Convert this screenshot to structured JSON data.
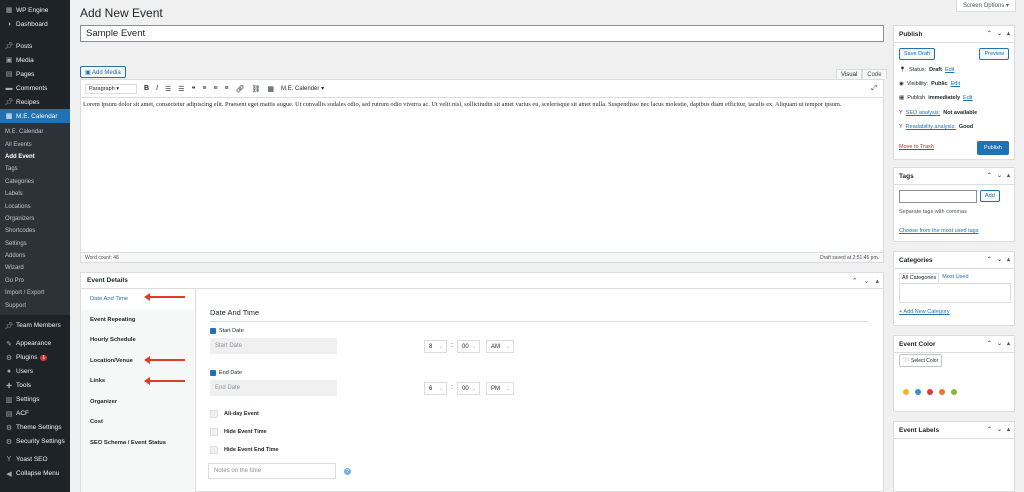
{
  "sidebar": {
    "top": [
      {
        "label": "WP Engine",
        "icon": "wpengine-icon"
      },
      {
        "label": "Dashboard",
        "icon": "dashboard-icon"
      },
      {
        "label": "Posts",
        "icon": "pin-icon"
      },
      {
        "label": "Media",
        "icon": "media-icon"
      },
      {
        "label": "Pages",
        "icon": "pages-icon"
      },
      {
        "label": "Comments",
        "icon": "comments-icon"
      },
      {
        "label": "Recipes",
        "icon": "pin-icon"
      },
      {
        "label": "M.E. Calendar",
        "icon": "calendar-icon"
      }
    ],
    "sub": [
      "M.E. Calendar",
      "All Events",
      "Add Event",
      "Tags",
      "Categories",
      "Labels",
      "Locations",
      "Organizers",
      "Shortcodes",
      "Settings",
      "Addons",
      "Wizard",
      "Go Pro",
      "Import / Export",
      "Support"
    ],
    "bottom": [
      {
        "label": "Team Members",
        "icon": "pin-icon"
      },
      {
        "label": "Appearance",
        "icon": "appearance-icon"
      },
      {
        "label": "Plugins",
        "icon": "plugins-icon",
        "badge": "1"
      },
      {
        "label": "Users",
        "icon": "users-icon"
      },
      {
        "label": "Tools",
        "icon": "tools-icon"
      },
      {
        "label": "Settings",
        "icon": "settings-icon"
      },
      {
        "label": "ACF",
        "icon": "acf-icon"
      },
      {
        "label": "Theme Settings",
        "icon": "gear-icon"
      },
      {
        "label": "Security Settings",
        "icon": "gear-icon"
      },
      {
        "label": "Yoast SEO",
        "icon": "yoast-icon"
      },
      {
        "label": "Collapse Menu",
        "icon": "collapse-icon"
      }
    ]
  },
  "header": {
    "title": "Add New Event",
    "screen_options": "Screen Options ▾"
  },
  "post_title": "Sample Event",
  "editor": {
    "add_media": "Add Media",
    "tab_visual": "Visual",
    "tab_code": "Code",
    "format": "Paragraph",
    "shortcode": "M.E. Calender",
    "content": "Lorem ipsum dolor sit amet, consectetur adipiscing elit. Praesent eget mattis augue. Ut convallis sodales odio, sed rutrum odio viverra ac. Ut velit nisl, sollicitudin sit amet varius eu, scelerisque sit amet nulla. Suspendisse nec lacus molestie, dapibus diam efficitur, iaculis ex. Aliquam ut tempor ipsum.",
    "word_count": "Word count: 46",
    "draft_saved": "Draft saved at 2:51:46 pm."
  },
  "event_details": {
    "title": "Event Details",
    "tabs": [
      "Date And Time",
      "Event Repeating",
      "Hourly Schedule",
      "Location/Venue",
      "Links",
      "Organizer",
      "Cost",
      "SEO Schema / Event Status"
    ],
    "section_title": "Date And Time",
    "start_label": "Start Date",
    "start_placeholder": "Start Date",
    "start_hour": "8",
    "start_min": "00",
    "start_ampm": "AM",
    "end_label": "End Date",
    "end_placeholder": "End Date",
    "end_hour": "6",
    "end_min": "00",
    "end_ampm": "PM",
    "colon": ":",
    "allday": "All-day Event",
    "hide_time": "Hide Event Time",
    "hide_end": "Hide Event End Time",
    "notes_placeholder": "Notes on the time",
    "arrow_color": "#e33b25"
  },
  "publish": {
    "title": "Publish",
    "save_draft": "Save Draft",
    "preview": "Preview",
    "status": "Status: ",
    "status_val": "Draft",
    "status_edit": "Edit",
    "visibility": "Visibility: ",
    "visibility_val": "Public",
    "visibility_edit": "Edit",
    "publish_when": "Publish ",
    "publish_when_val": "immediately",
    "publish_edit": "Edit",
    "seo": "SEO analysis:",
    "seo_val": "Not available",
    "read": "Readability analysis:",
    "read_val": "Good",
    "trash": "Move to Trash",
    "publish_btn": "Publish"
  },
  "tags": {
    "title": "Tags",
    "add": "Add",
    "hint": "Separate tags with commas",
    "choose": "Choose from the most used tags"
  },
  "categories": {
    "title": "Categories",
    "tab_all": "All Categories",
    "tab_most": "Most Used",
    "add_new": "+ Add New Category"
  },
  "event_color": {
    "title": "Event Color",
    "select": "Select Color",
    "swatches": [
      "#f0b81e",
      "#3a8fd6",
      "#dd3b3b",
      "#e57833",
      "#8db532"
    ]
  },
  "event_labels": {
    "title": "Event Labels"
  }
}
